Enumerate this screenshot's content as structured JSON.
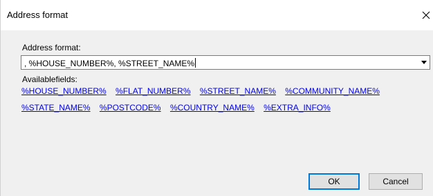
{
  "dialog": {
    "title": "Address format",
    "close_icon": "close-icon"
  },
  "form": {
    "format_label": "Address format:",
    "format_value": ", %HOUSE_NUMBER%, %STREET_NAME%",
    "fields_label": "Availablefields:",
    "fields_row1": [
      "%HOUSE_NUMBER%",
      "%FLAT_NUMBER%",
      "%STREET_NAME%",
      "%COMMUNITY_NAME%"
    ],
    "fields_row2": [
      "%STATE_NAME%",
      "%POSTCODE%",
      "%COUNTRY_NAME%",
      "%EXTRA_INFO%"
    ]
  },
  "buttons": {
    "ok": "OK",
    "cancel": "Cancel"
  },
  "colors": {
    "link": "#0000ee",
    "default_button_border": "#0078d7"
  }
}
